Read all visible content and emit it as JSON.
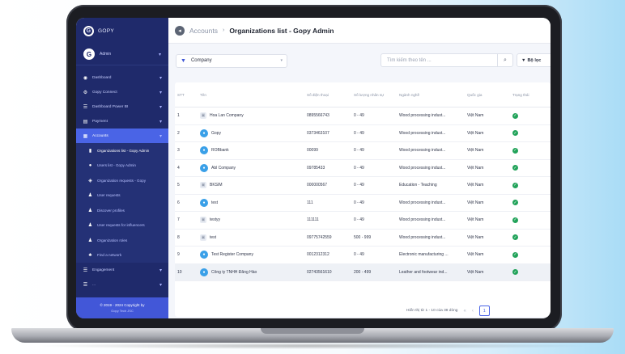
{
  "app": {
    "brand": "GOPY",
    "user_name": "Admin"
  },
  "sidebar": {
    "items": [
      {
        "icon": "dashboard-icon",
        "glyph": "◉",
        "label": "Dashboard",
        "active": false
      },
      {
        "icon": "settings-icon",
        "glyph": "⚙",
        "label": "Gopy Connect",
        "active": false
      },
      {
        "icon": "dashboard-list-icon",
        "glyph": "☰",
        "label": "Dashboard Power BI",
        "active": false
      },
      {
        "icon": "payment-icon",
        "glyph": "▤",
        "label": "Payment",
        "active": false
      },
      {
        "icon": "accounts-icon",
        "glyph": "▦",
        "label": "Accounts",
        "active": true
      }
    ],
    "subitems": [
      {
        "icon": "building-icon",
        "glyph": "▮",
        "label": "Organizations list - Gopy Admin",
        "active": true
      },
      {
        "icon": "user-icon",
        "glyph": "●",
        "label": "Users list - Gopy Admin",
        "active": false
      },
      {
        "icon": "org-request-icon",
        "glyph": "◈",
        "label": "Organization requests - Gopy",
        "active": false
      },
      {
        "icon": "user-request-icon",
        "glyph": "♟",
        "label": "User requests",
        "active": false
      },
      {
        "icon": "profile-icon",
        "glyph": "♟",
        "label": "Discover profiles",
        "active": false
      },
      {
        "icon": "user-request-icon",
        "glyph": "♟",
        "label": "User requests for influencers",
        "active": false
      },
      {
        "icon": "users-icon",
        "glyph": "♟",
        "label": "Organization roles",
        "active": false
      },
      {
        "icon": "network-icon",
        "glyph": "♣",
        "label": "Find a network",
        "active": false
      }
    ],
    "more_items": [
      {
        "icon": "engagement-icon",
        "glyph": "☰",
        "label": "Engagement",
        "active": false
      },
      {
        "icon": "menu-icon",
        "glyph": "☰",
        "label": "...",
        "active": false
      }
    ],
    "copyright": "© 2019 - 2024 Copyright by",
    "copyright_sub": "Gopy Tech JSC"
  },
  "header": {
    "parent": "Accounts",
    "separator": "›",
    "current": "Organizations list - Gopy Admin"
  },
  "filters": {
    "select_value": "Company",
    "search_placeholder": "Tìm kiếm theo tên ...",
    "filter_label": "Bộ lọc"
  },
  "table": {
    "columns": [
      "STT",
      "Tên",
      "Số điện thoại",
      "Số lượng nhân sự",
      "Ngành nghề",
      "Quốc gia",
      "Trạng thái"
    ],
    "rows": [
      {
        "stt": "1",
        "name": "Hoa Lan Company",
        "icon": "image",
        "phone": "0895566743",
        "staff": "0 - 49",
        "industry": "Wood processing indust...",
        "country": "Việt Nam",
        "highlight": false
      },
      {
        "stt": "2",
        "name": "Gopy",
        "icon": "avatar",
        "phone": "0373463107",
        "staff": "0 - 49",
        "industry": "Wood processing indust...",
        "country": "Việt Nam",
        "highlight": false
      },
      {
        "stt": "3",
        "name": "ROBbank",
        "icon": "avatar",
        "phone": "00099",
        "staff": "0 - 49",
        "industry": "Wood processing indust...",
        "country": "Việt Nam",
        "highlight": false
      },
      {
        "stt": "4",
        "name": "Abl Company",
        "icon": "avatar",
        "phone": "09785433",
        "staff": "0 - 49",
        "industry": "Wood processing indust...",
        "country": "Việt Nam",
        "highlight": false
      },
      {
        "stt": "5",
        "name": "BKSIM",
        "icon": "image",
        "phone": "000000567",
        "staff": "0 - 49",
        "industry": "Education - Teaching",
        "country": "Việt Nam",
        "highlight": false
      },
      {
        "stt": "6",
        "name": "test",
        "icon": "avatar",
        "phone": "111",
        "staff": "0 - 49",
        "industry": "Wood processing indust...",
        "country": "Việt Nam",
        "highlight": false
      },
      {
        "stt": "7",
        "name": "testyy",
        "icon": "image",
        "phone": "111111",
        "staff": "0 - 49",
        "industry": "Wood processing indust...",
        "country": "Việt Nam",
        "highlight": false
      },
      {
        "stt": "8",
        "name": "test",
        "icon": "image",
        "phone": "09775742559",
        "staff": "500 - 999",
        "industry": "Wood processing indust...",
        "country": "Việt Nam",
        "highlight": false
      },
      {
        "stt": "9",
        "name": "Test Register Company",
        "icon": "avatar",
        "phone": "0012312312",
        "staff": "0 - 49",
        "industry": "Electronic manufacturing ...",
        "country": "Việt Nam",
        "highlight": false
      },
      {
        "stt": "10",
        "name": "Công ty TNHH Đăng Hào",
        "icon": "avatar",
        "phone": "02743561610",
        "staff": "200 - 499",
        "industry": "Leather and footwear ind...",
        "country": "Việt Nam",
        "highlight": true
      }
    ]
  },
  "pagination": {
    "summary": "Hiển thị từ 1 - 10 của 38 dòng",
    "prev": "«",
    "prev_one": "‹",
    "current_page": "1"
  },
  "colors": {
    "sidebar_bg": "#1f2a6b",
    "accent": "#4a64e6",
    "status_ok": "#22a35a"
  }
}
